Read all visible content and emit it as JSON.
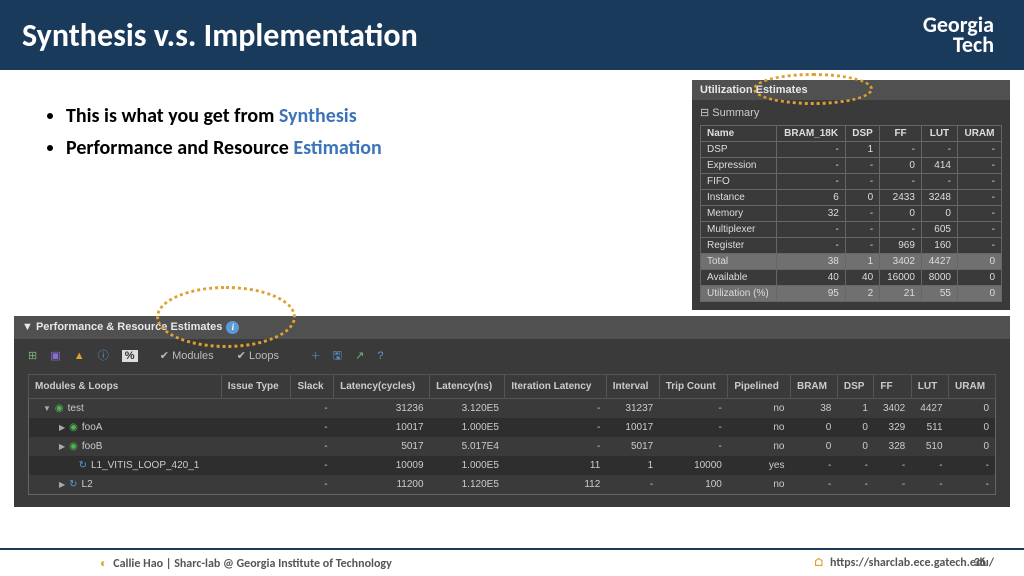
{
  "slide": {
    "title": "Synthesis v.s. Implementation",
    "logo_line1": "Georgia",
    "logo_line2": "Tech"
  },
  "bullets": {
    "b1_pre": "This is what you get from ",
    "b1_em": "Synthesis",
    "b2_pre": "Performance and Resource ",
    "b2_em": "Estimation"
  },
  "util": {
    "header": "Utilization Estimates",
    "summary": "⊟ Summary",
    "cols": [
      "Name",
      "BRAM_18K",
      "DSP",
      "FF",
      "LUT",
      "URAM"
    ],
    "rows": [
      {
        "n": "DSP",
        "b": "-",
        "d": "1",
        "f": "-",
        "l": "-",
        "u": "-"
      },
      {
        "n": "Expression",
        "b": "-",
        "d": "-",
        "f": "0",
        "l": "414",
        "u": "-"
      },
      {
        "n": "FIFO",
        "b": "-",
        "d": "-",
        "f": "-",
        "l": "-",
        "u": "-"
      },
      {
        "n": "Instance",
        "b": "6",
        "d": "0",
        "f": "2433",
        "l": "3248",
        "u": "-"
      },
      {
        "n": "Memory",
        "b": "32",
        "d": "-",
        "f": "0",
        "l": "0",
        "u": "-"
      },
      {
        "n": "Multiplexer",
        "b": "-",
        "d": "-",
        "f": "-",
        "l": "605",
        "u": "-"
      },
      {
        "n": "Register",
        "b": "-",
        "d": "-",
        "f": "969",
        "l": "160",
        "u": "-"
      }
    ],
    "total": {
      "n": "Total",
      "b": "38",
      "d": "1",
      "f": "3402",
      "l": "4427",
      "u": "0"
    },
    "avail": {
      "n": "Available",
      "b": "40",
      "d": "40",
      "f": "16000",
      "l": "8000",
      "u": "0"
    },
    "pct": {
      "n": "Utilization (%)",
      "b": "95",
      "d": "2",
      "f": "21",
      "l": "55",
      "u": "0"
    }
  },
  "perf": {
    "header": "▼ Performance & Resource Estimates",
    "toolbar": {
      "modules": "Modules",
      "loops": "Loops"
    },
    "cols": [
      "Modules & Loops",
      "Issue Type",
      "Slack",
      "Latency(cycles)",
      "Latency(ns)",
      "Iteration Latency",
      "Interval",
      "Trip Count",
      "Pipelined",
      "BRAM",
      "DSP",
      "FF",
      "LUT",
      "URAM"
    ],
    "rows": [
      {
        "name": "test",
        "lc": "31236",
        "ln": "3.120E5",
        "il": "-",
        "iv": "31237",
        "tc": "-",
        "pl": "no",
        "br": "38",
        "dsp": "1",
        "ff": "3402",
        "lut": "4427",
        "ur": "0",
        "ind": 1,
        "type": "mod",
        "exp": "▼"
      },
      {
        "name": "fooA",
        "lc": "10017",
        "ln": "1.000E5",
        "il": "-",
        "iv": "10017",
        "tc": "-",
        "pl": "no",
        "br": "0",
        "dsp": "0",
        "ff": "329",
        "lut": "511",
        "ur": "0",
        "ind": 2,
        "type": "mod",
        "exp": "▶"
      },
      {
        "name": "fooB",
        "lc": "5017",
        "ln": "5.017E4",
        "il": "-",
        "iv": "5017",
        "tc": "-",
        "pl": "no",
        "br": "0",
        "dsp": "0",
        "ff": "328",
        "lut": "510",
        "ur": "0",
        "ind": 2,
        "type": "mod",
        "exp": "▶"
      },
      {
        "name": "L1_VITIS_LOOP_420_1",
        "lc": "10009",
        "ln": "1.000E5",
        "il": "11",
        "iv": "1",
        "tc": "10000",
        "pl": "yes",
        "br": "-",
        "dsp": "-",
        "ff": "-",
        "lut": "-",
        "ur": "-",
        "ind": 3,
        "type": "loop",
        "exp": ""
      },
      {
        "name": "L2",
        "lc": "11200",
        "ln": "1.120E5",
        "il": "112",
        "iv": "-",
        "tc": "100",
        "pl": "no",
        "br": "-",
        "dsp": "-",
        "ff": "-",
        "lut": "-",
        "ur": "-",
        "ind": 2,
        "type": "loop",
        "exp": "▶"
      }
    ]
  },
  "footer": {
    "left": "Callie Hao | Sharc-lab @ Georgia Institute of Technology",
    "right": "https://sharclab.ece.gatech.edu/",
    "page": "36"
  }
}
